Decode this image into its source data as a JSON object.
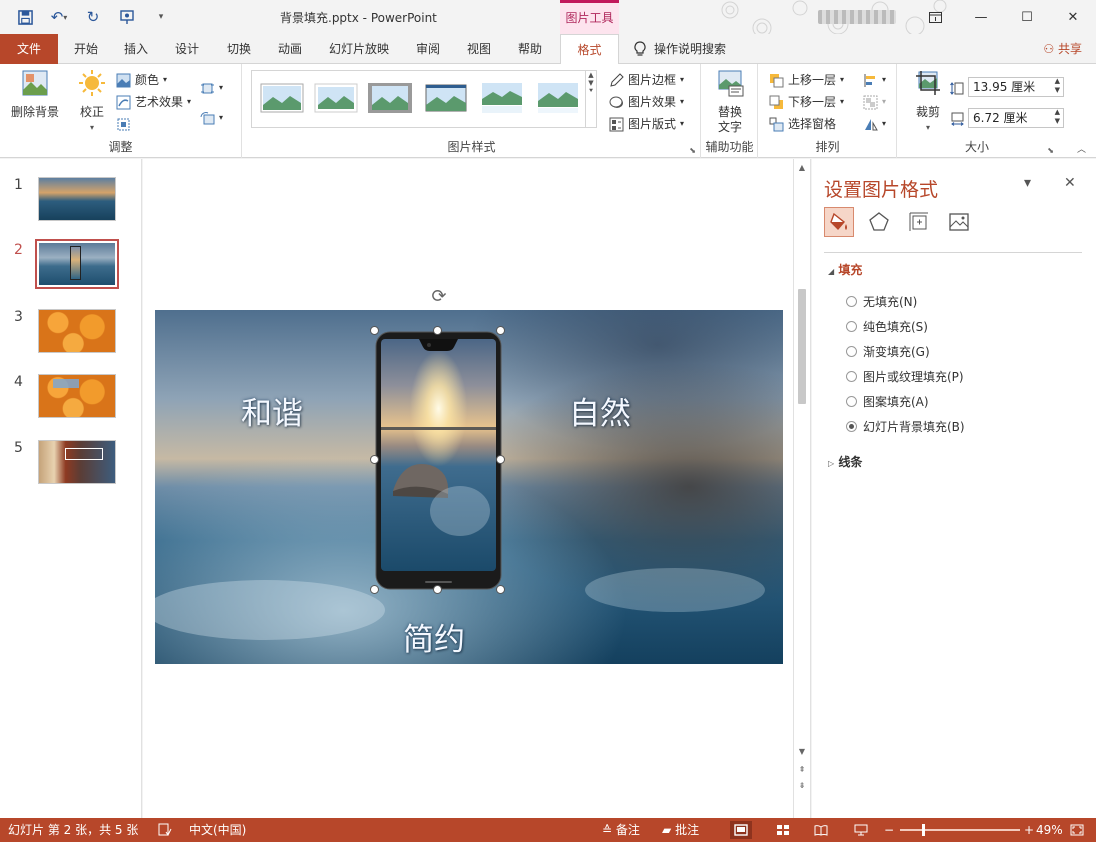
{
  "window": {
    "doc_title": "背景填充.pptx  -  PowerPoint",
    "contextual_group": "图片工具",
    "share_label": "共享",
    "tell_me": "操作说明搜索"
  },
  "tabs": [
    {
      "label": "文件"
    },
    {
      "label": "开始"
    },
    {
      "label": "插入"
    },
    {
      "label": "设计"
    },
    {
      "label": "切换"
    },
    {
      "label": "动画"
    },
    {
      "label": "幻灯片放映"
    },
    {
      "label": "审阅"
    },
    {
      "label": "视图"
    },
    {
      "label": "帮助"
    },
    {
      "label": "格式"
    }
  ],
  "ribbon": {
    "adjust": {
      "group_label": "调整",
      "remove_bg": "删除背景",
      "correct": "校正",
      "color": "颜色",
      "art_effects": "艺术效果"
    },
    "styles": {
      "group_label": "图片样式",
      "border": "图片边框",
      "effects": "图片效果",
      "layout": "图片版式"
    },
    "access": {
      "group_label": "辅助功能",
      "alt_text": "替换\n文字",
      "alt_line1": "替换",
      "alt_line2": "文字"
    },
    "arrange": {
      "group_label": "排列",
      "bring_forward": "上移一层",
      "send_backward": "下移一层",
      "selection_pane": "选择窗格"
    },
    "size": {
      "group_label": "大小",
      "crop": "裁剪",
      "height": "13.95 厘米",
      "width": "6.72 厘米"
    }
  },
  "slides": [
    {
      "num": "1"
    },
    {
      "num": "2"
    },
    {
      "num": "3"
    },
    {
      "num": "4"
    },
    {
      "num": "5"
    }
  ],
  "slide_content": {
    "text_left": "和谐",
    "text_right": "自然",
    "text_bottom": "简约"
  },
  "format_pane": {
    "title": "设置图片格式",
    "fill_section": "填充",
    "line_section": "线条",
    "options": [
      {
        "label": "无填充(N)",
        "checked": false
      },
      {
        "label": "纯色填充(S)",
        "checked": false
      },
      {
        "label": "渐变填充(G)",
        "checked": false
      },
      {
        "label": "图片或纹理填充(P)",
        "checked": false
      },
      {
        "label": "图案填充(A)",
        "checked": false
      },
      {
        "label": "幻灯片背景填充(B)",
        "checked": true
      }
    ]
  },
  "status": {
    "slide_info": "幻灯片 第 2 张，共 5 张",
    "language": "中文(中国)",
    "notes": "备注",
    "comments": "批注",
    "zoom": "49%"
  },
  "colors": {
    "accent": "#b7472a",
    "contextual": "#c2185b"
  }
}
